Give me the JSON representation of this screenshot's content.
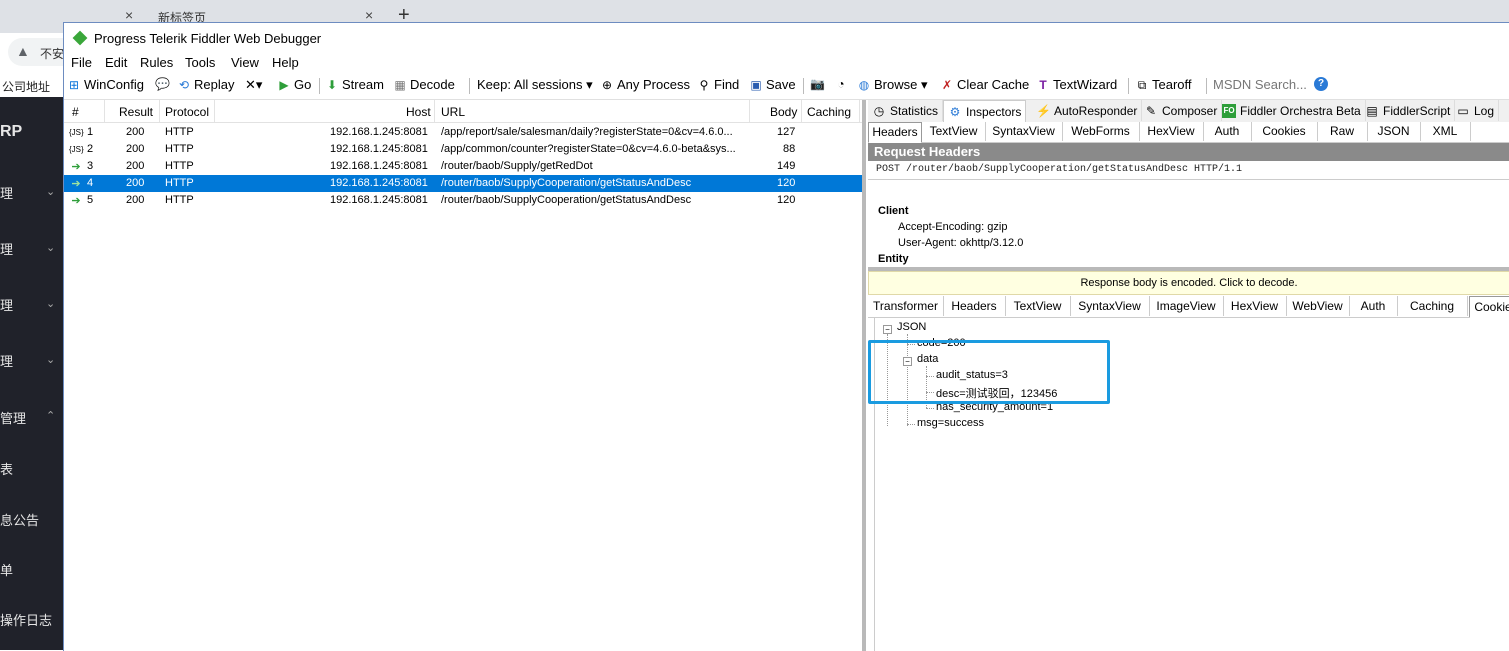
{
  "browser": {
    "tab_close": "×",
    "new_tab_title": "新标签页",
    "new_tab_plus": "+",
    "address_prefix": "不安",
    "bookmark": "公司地址",
    "sidebar": {
      "logo": "RP",
      "items": [
        "理",
        "理",
        "理",
        "理",
        "管理",
        "表",
        "息公告",
        "单",
        "操作日志"
      ]
    }
  },
  "window": {
    "title": "Progress Telerik Fiddler Web Debugger"
  },
  "menu": {
    "file": "File",
    "edit": "Edit",
    "rules": "Rules",
    "tools": "Tools",
    "view": "View",
    "help": "Help"
  },
  "toolbar": {
    "winconfig": "WinConfig",
    "replay": "Replay",
    "remove": "✕▾",
    "go": "Go",
    "stream": "Stream",
    "decode": "Decode",
    "keep": "Keep: All sessions ▾",
    "process": "Any Process",
    "find": "Find",
    "save": "Save",
    "browse": "Browse ▾",
    "clear_cache": "Clear Cache",
    "textwizard": "TextWizard",
    "tearoff": "Tearoff",
    "msdn": "MSDN Search...",
    "help": "?"
  },
  "sessions": {
    "columns": {
      "num": "#",
      "result": "Result",
      "protocol": "Protocol",
      "host": "Host",
      "url": "URL",
      "body": "Body",
      "caching": "Caching"
    },
    "rows": [
      {
        "num": "1",
        "result": "200",
        "protocol": "HTTP",
        "host": "192.168.1.245:8081",
        "url": "/app/report/sale/salesman/daily?registerState=0&cv=4.6.0...",
        "body": "127",
        "icon": "{JS}"
      },
      {
        "num": "2",
        "result": "200",
        "protocol": "HTTP",
        "host": "192.168.1.245:8081",
        "url": "/app/common/counter?registerState=0&cv=4.6.0-beta&sys...",
        "body": "88",
        "icon": "{JS}"
      },
      {
        "num": "3",
        "result": "200",
        "protocol": "HTTP",
        "host": "192.168.1.245:8081",
        "url": "/router/baob/Supply/getRedDot",
        "body": "149",
        "icon": "➔"
      },
      {
        "num": "4",
        "result": "200",
        "protocol": "HTTP",
        "host": "192.168.1.245:8081",
        "url": "/router/baob/SupplyCooperation/getStatusAndDesc",
        "body": "120",
        "icon": "➔"
      },
      {
        "num": "5",
        "result": "200",
        "protocol": "HTTP",
        "host": "192.168.1.245:8081",
        "url": "/router/baob/SupplyCooperation/getStatusAndDesc",
        "body": "120",
        "icon": "➔"
      }
    ]
  },
  "top_tabs": {
    "statistics": "Statistics",
    "inspectors": "Inspectors",
    "autoresponder": "AutoResponder",
    "composer": "Composer",
    "orchestra": "Fiddler Orchestra Beta",
    "fiddlerscript": "FiddlerScript",
    "log": "Log"
  },
  "request_tabs": [
    "Headers",
    "TextView",
    "SyntaxView",
    "WebForms",
    "HexView",
    "Auth",
    "Cookies",
    "Raw",
    "JSON",
    "XML"
  ],
  "request": {
    "title": "Request Headers",
    "line": "POST /router/baob/SupplyCooperation/getStatusAndDesc HTTP/1.1",
    "client_group": "Client",
    "accept_encoding": "Accept-Encoding: gzip",
    "user_agent": "User-Agent: okhttp/3.12.0",
    "entity_group": "Entity"
  },
  "response": {
    "encoded_notice": "Response body is encoded. Click to decode.",
    "tabs": [
      "Transformer",
      "Headers",
      "TextView",
      "SyntaxView",
      "ImageView",
      "HexView",
      "WebView",
      "Auth",
      "Caching",
      "Cookie"
    ],
    "tree": {
      "root": "JSON",
      "code": "code=200",
      "data": "data",
      "audit_status": "audit_status=3",
      "desc": "desc=测试驳回，123456",
      "has_security_amount": "has_security_amount=1",
      "msg": "msg=success"
    }
  },
  "colors": {
    "selection": "#0078d7",
    "highlight_box": "#1a9be0",
    "panel_header": "#8a8a8a",
    "notice_bg": "#ffffe1"
  }
}
